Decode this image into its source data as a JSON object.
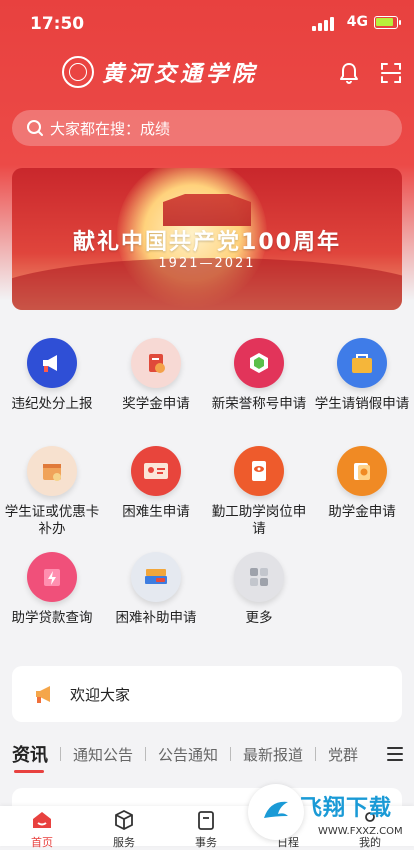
{
  "status_bar": {
    "time": "17:50",
    "network": "4G"
  },
  "header": {
    "school_name": "黄河交通学院"
  },
  "search": {
    "placeholder": "大家都在搜：成绩"
  },
  "banner": {
    "title": "献礼中国共产党100周年",
    "years": "1921—2021"
  },
  "services": [
    {
      "label": "违纪处分上报",
      "icon": "megaphone-icon",
      "color": "#2f4fd6"
    },
    {
      "label": "奖学金申请",
      "icon": "certificate-icon",
      "color": "#f7d9d4"
    },
    {
      "label": "新荣誉称号申请",
      "icon": "medal-icon",
      "color": "#e2345a"
    },
    {
      "label": "学生请销假申请",
      "icon": "bag-icon",
      "color": "#3f7ce8"
    },
    {
      "label": "学生证或优惠卡补办",
      "icon": "card-calendar-icon",
      "color": "#f7e1cf"
    },
    {
      "label": "困难生申请",
      "icon": "id-card-icon",
      "color": "#e8453c"
    },
    {
      "label": "勤工助学岗位申请",
      "icon": "document-eye-icon",
      "color": "#ee5b2c"
    },
    {
      "label": "助学金申请",
      "icon": "coin-cards-icon",
      "color": "#f08a24"
    },
    {
      "label": "助学贷款查询",
      "icon": "lightning-card-icon",
      "color": "#f0507a"
    },
    {
      "label": "困难补助申请",
      "icon": "money-stack-icon",
      "color": "#e5e9f0"
    },
    {
      "label": "更多",
      "icon": "grid-icon",
      "color": "#e2e2e6"
    }
  ],
  "notice": {
    "text": "欢迎大家"
  },
  "news_tabs": [
    "资讯",
    "通知公告",
    "公告通知",
    "最新报道",
    "党群"
  ],
  "bottom_nav": [
    {
      "label": "首页",
      "icon": "home-icon"
    },
    {
      "label": "服务",
      "icon": "cube-icon"
    },
    {
      "label": "事务",
      "icon": "clipboard-icon"
    },
    {
      "label": "日程",
      "icon": "calendar-icon"
    },
    {
      "label": "我的",
      "icon": "user-icon"
    }
  ],
  "watermark": {
    "text": "飞翔下载",
    "url": "WWW.FXXZ.COM"
  },
  "colors": {
    "primary": "#e8413f",
    "background": "#f3f3f5"
  }
}
